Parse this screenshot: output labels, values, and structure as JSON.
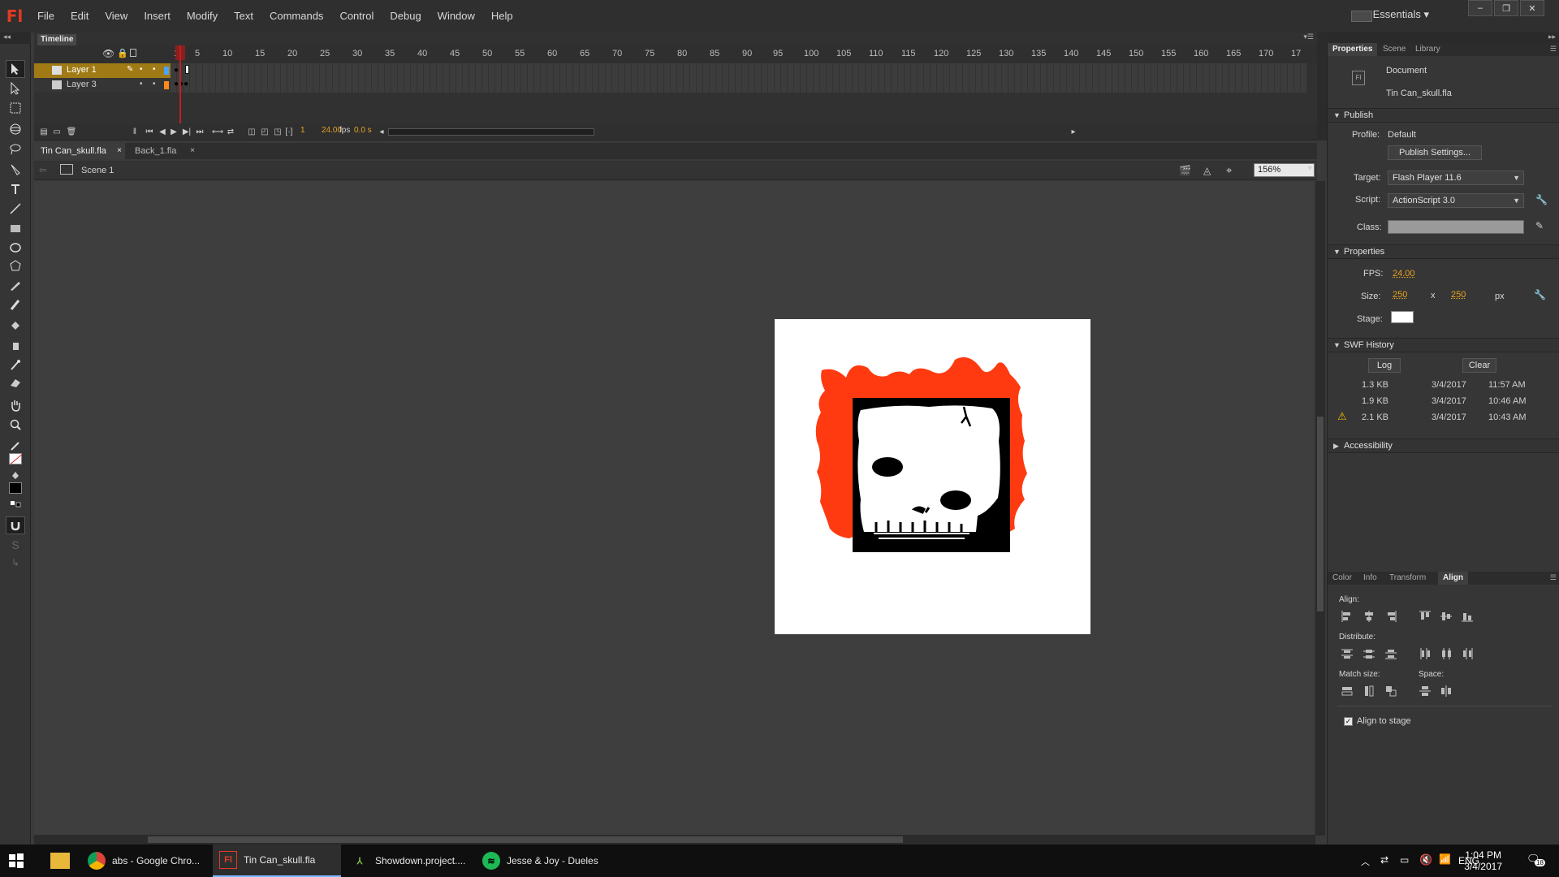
{
  "app": {
    "logo": "Fl",
    "menu": [
      "File",
      "Edit",
      "View",
      "Insert",
      "Modify",
      "Text",
      "Commands",
      "Control",
      "Debug",
      "Window",
      "Help"
    ],
    "workspace": "Essentials",
    "window_buttons": [
      "–",
      "❐",
      "✕"
    ]
  },
  "timeline": {
    "tab_label": "Timeline",
    "ruler": [
      "1",
      "5",
      "10",
      "15",
      "20",
      "25",
      "30",
      "35",
      "40",
      "45",
      "50",
      "55",
      "60",
      "65",
      "70",
      "75",
      "80",
      "85",
      "90",
      "95",
      "100",
      "105",
      "110",
      "115",
      "120",
      "125",
      "130",
      "135",
      "140",
      "145",
      "150",
      "155",
      "160",
      "165",
      "170",
      "17"
    ],
    "layers": [
      {
        "name": "Layer 1",
        "selected": true
      },
      {
        "name": "Layer 3",
        "selected": false
      }
    ],
    "current_frame": "1",
    "fps": "24.00",
    "fps_unit": "fps",
    "time": "0.0 s"
  },
  "documents": {
    "tabs": [
      {
        "name": "Tin Can_skull.fla",
        "active": true
      },
      {
        "name": "Back_1.fla",
        "active": false
      }
    ],
    "scene": "Scene 1",
    "zoom": "156%"
  },
  "properties": {
    "tabs": [
      "Properties",
      "Scene",
      "Library"
    ],
    "doc_type": "Document",
    "doc_name": "Tin Can_skull.fla",
    "publish_header": "Publish",
    "profile_label": "Profile:",
    "profile_value": "Default",
    "publish_settings": "Publish Settings...",
    "target_label": "Target:",
    "target_value": "Flash Player 11.6",
    "script_label": "Script:",
    "script_value": "ActionScript 3.0",
    "class_label": "Class:",
    "props_header": "Properties",
    "fps_label": "FPS:",
    "fps_value": "24.00",
    "size_label": "Size:",
    "size_w": "250",
    "size_x": "x",
    "size_h": "250",
    "size_unit": "px",
    "stage_label": "Stage:",
    "stage_color": "#ffffff",
    "swf_header": "SWF History",
    "log_btn": "Log",
    "clear_btn": "Clear",
    "history": [
      {
        "size": "1.3 KB",
        "date": "3/4/2017",
        "time": "11:57 AM",
        "warn": false
      },
      {
        "size": "1.9 KB",
        "date": "3/4/2017",
        "time": "10:46 AM",
        "warn": false
      },
      {
        "size": "2.1 KB",
        "date": "3/4/2017",
        "time": "10:43 AM",
        "warn": true
      }
    ],
    "accessibility_header": "Accessibility"
  },
  "align_panel": {
    "tabs": [
      "Color",
      "Info",
      "Transform",
      "Align"
    ],
    "align_label": "Align:",
    "distribute_label": "Distribute:",
    "match_label": "Match size:",
    "space_label": "Space:",
    "align_to_stage": "Align to stage",
    "align_to_stage_checked": true
  },
  "taskbar": {
    "tasks": [
      {
        "label": "abs - Google Chro...",
        "icon": "chrome-icon"
      },
      {
        "label": "Tin Can_skull.fla",
        "icon": "flash-icon"
      },
      {
        "label": "Showdown.project....",
        "icon": "project-icon"
      },
      {
        "label": "Jesse & Joy - Dueles",
        "icon": "spotify-icon"
      }
    ],
    "language": "ENG",
    "time": "1:04 PM",
    "date": "3/4/2017",
    "notifications": "18"
  },
  "colors": {
    "accent_orange": "#e6a220",
    "flame_red": "#ff3a10",
    "layer_selected": "#b8860b"
  }
}
